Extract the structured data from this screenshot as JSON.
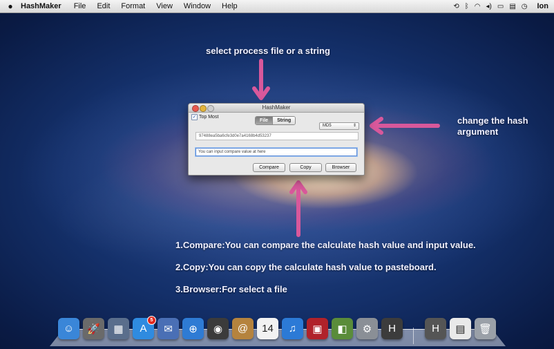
{
  "menubar": {
    "app_name": "HashMaker",
    "items": [
      "File",
      "Edit",
      "Format",
      "View",
      "Window",
      "Help"
    ],
    "user": "Ion"
  },
  "annotations": {
    "top": "select process file or a string",
    "right_line1": "change the hash",
    "right_line2": "argument",
    "item1": "1.Compare:You can compare the calculate hash value and input value.",
    "item2": "2.Copy:You can copy the calculate hash value to pasteboard.",
    "item3": "3.Browser:For select a file",
    "arrow_color": "#d8589b"
  },
  "window": {
    "title": "HashMaker",
    "top_most_label": "Top Most",
    "top_most_checked": true,
    "segments": [
      "File",
      "String"
    ],
    "selected_segment": "File",
    "algorithm": "MD5",
    "hash_value": "97488ea5ba6cfe3d0e7a4168b4d53237",
    "compare_placeholder": "You can input compare value at here",
    "buttons": {
      "compare": "Compare",
      "copy": "Copy",
      "browser": "Browser"
    }
  },
  "dock": {
    "items": [
      {
        "name": "finder-icon",
        "glyph": "☺",
        "color": "#3a86d8"
      },
      {
        "name": "launchpad-icon",
        "glyph": "🚀",
        "color": "#6a6a6a"
      },
      {
        "name": "mission-control-icon",
        "glyph": "▦",
        "color": "#5a6e8c"
      },
      {
        "name": "app-store-icon",
        "glyph": "A",
        "color": "#2f8be0",
        "badge": "5"
      },
      {
        "name": "mail-icon",
        "glyph": "✉",
        "color": "#4a6fb5"
      },
      {
        "name": "safari-icon",
        "glyph": "⊕",
        "color": "#2e7bd4"
      },
      {
        "name": "facetime-icon",
        "glyph": "◉",
        "color": "#3b3b3b"
      },
      {
        "name": "address-book-icon",
        "glyph": "@",
        "color": "#b5833e"
      },
      {
        "name": "calendar-icon",
        "glyph": "14",
        "color": "#f2f2f2"
      },
      {
        "name": "itunes-icon",
        "glyph": "♫",
        "color": "#2c7ad6"
      },
      {
        "name": "photo-booth-icon",
        "glyph": "▣",
        "color": "#b0222a"
      },
      {
        "name": "iphoto-icon",
        "glyph": "◧",
        "color": "#5a8c3a"
      },
      {
        "name": "system-preferences-icon",
        "glyph": "⚙",
        "color": "#8a8f96"
      },
      {
        "name": "hashmaker-dock-icon",
        "glyph": "H",
        "color": "#3c3c3c"
      },
      {
        "name": "hashmaker-stack-icon",
        "glyph": "H",
        "color": "#555"
      },
      {
        "name": "document-stack-icon",
        "glyph": "▤",
        "color": "#e9e9e9"
      },
      {
        "name": "trash-icon",
        "glyph": "🗑",
        "color": "#9aa0a8"
      }
    ]
  }
}
